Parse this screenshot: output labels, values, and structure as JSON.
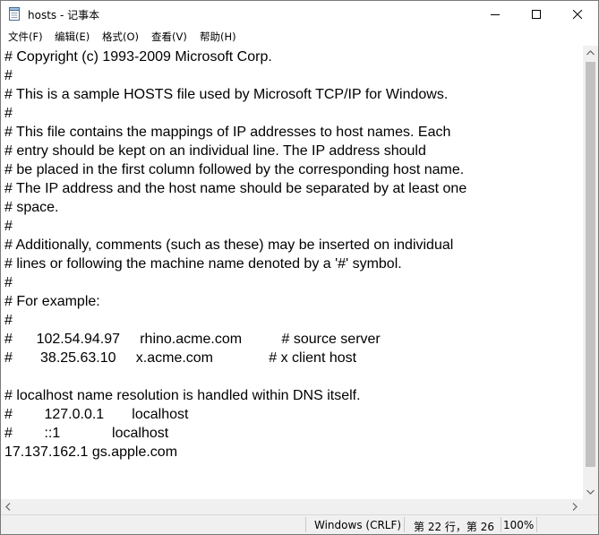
{
  "window": {
    "title": "hosts - 记事本"
  },
  "menu": [
    {
      "label": "文件(F)"
    },
    {
      "label": "编辑(E)"
    },
    {
      "label": "格式(O)"
    },
    {
      "label": "查看(V)"
    },
    {
      "label": "帮助(H)"
    }
  ],
  "editor": {
    "lines": [
      "# Copyright (c) 1993-2009 Microsoft Corp.",
      "#",
      "# This is a sample HOSTS file used by Microsoft TCP/IP for Windows.",
      "#",
      "# This file contains the mappings of IP addresses to host names. Each",
      "# entry should be kept on an individual line. The IP address should",
      "# be placed in the first column followed by the corresponding host name.",
      "# The IP address and the host name should be separated by at least one",
      "# space.",
      "#",
      "# Additionally, comments (such as these) may be inserted on individual",
      "# lines or following the machine name denoted by a '#' symbol.",
      "#",
      "# For example:",
      "#",
      "#      102.54.94.97     rhino.acme.com          # source server",
      "#       38.25.63.10     x.acme.com              # x client host",
      "",
      "# localhost name resolution is handled within DNS itself.",
      "#\t127.0.0.1       localhost",
      "#\t::1             localhost",
      "17.137.162.1 gs.apple.com"
    ]
  },
  "status": {
    "encoding": "Windows (CRLF)",
    "position": "第 22 行，第 26",
    "zoom": "100%"
  },
  "icons": {
    "app": "notepad-icon",
    "minimize": "minimize-icon",
    "maximize": "maximize-icon",
    "close": "close-icon",
    "scroll_up": "chevron-up-icon",
    "scroll_down": "chevron-down-icon",
    "scroll_left": "chevron-left-icon",
    "scroll_right": "chevron-right-icon"
  }
}
